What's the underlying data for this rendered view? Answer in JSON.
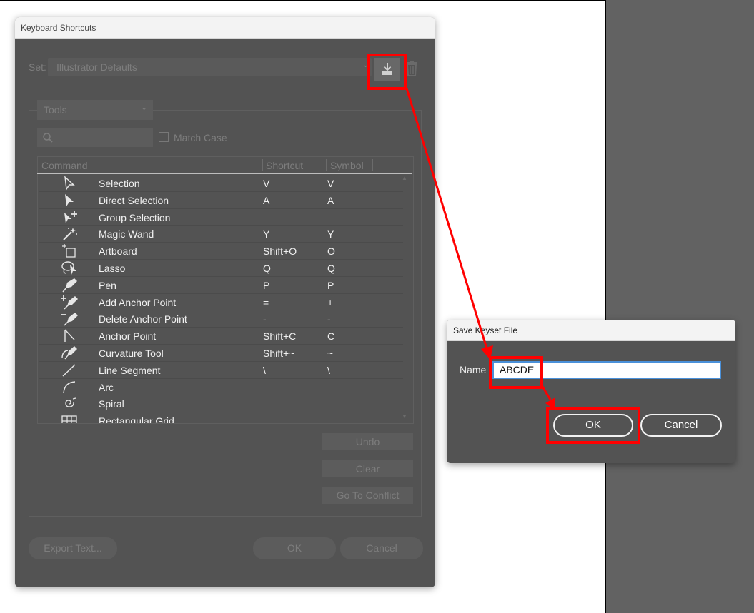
{
  "keyboard_shortcuts_dialog": {
    "title": "Keyboard Shortcuts",
    "set_label": "Set:",
    "set_value": "Illustrator Defaults",
    "tools_dropdown": "Tools",
    "match_case_label": "Match Case",
    "columns": {
      "command": "Command",
      "shortcut": "Shortcut",
      "symbol": "Symbol"
    },
    "rows": [
      {
        "command": "Selection",
        "shortcut": "V",
        "symbol": "V",
        "icon": "selection-tool-icon"
      },
      {
        "command": "Direct Selection",
        "shortcut": "A",
        "symbol": "A",
        "icon": "direct-selection-tool-icon"
      },
      {
        "command": "Group Selection",
        "shortcut": "",
        "symbol": "",
        "icon": "group-selection-tool-icon"
      },
      {
        "command": "Magic Wand",
        "shortcut": "Y",
        "symbol": "Y",
        "icon": "magic-wand-tool-icon"
      },
      {
        "command": "Artboard",
        "shortcut": "Shift+O",
        "symbol": "O",
        "icon": "artboard-tool-icon"
      },
      {
        "command": "Lasso",
        "shortcut": "Q",
        "symbol": "Q",
        "icon": "lasso-tool-icon"
      },
      {
        "command": "Pen",
        "shortcut": "P",
        "symbol": "P",
        "icon": "pen-tool-icon"
      },
      {
        "command": "Add Anchor Point",
        "shortcut": "=",
        "symbol": "+",
        "icon": "add-anchor-point-tool-icon"
      },
      {
        "command": "Delete Anchor Point",
        "shortcut": "-",
        "symbol": "-",
        "icon": "delete-anchor-point-tool-icon"
      },
      {
        "command": "Anchor Point",
        "shortcut": "Shift+C",
        "symbol": "C",
        "icon": "anchor-point-tool-icon"
      },
      {
        "command": "Curvature Tool",
        "shortcut": "Shift+~",
        "symbol": "~",
        "icon": "curvature-tool-icon"
      },
      {
        "command": "Line Segment",
        "shortcut": "\\",
        "symbol": "\\",
        "icon": "line-segment-tool-icon"
      },
      {
        "command": "Arc",
        "shortcut": "",
        "symbol": "",
        "icon": "arc-tool-icon"
      },
      {
        "command": "Spiral",
        "shortcut": "",
        "symbol": "",
        "icon": "spiral-tool-icon"
      },
      {
        "command": "Rectangular Grid",
        "shortcut": "",
        "symbol": "",
        "icon": "rectangular-grid-tool-icon"
      }
    ],
    "buttons": {
      "undo": "Undo",
      "clear": "Clear",
      "go_to_conflict": "Go To Conflict",
      "export_text": "Export Text...",
      "ok": "OK",
      "cancel": "Cancel"
    }
  },
  "save_keyset_dialog": {
    "title": "Save Keyset File",
    "name_label": "Name",
    "name_value": "ABCDE",
    "ok": "OK",
    "cancel": "Cancel"
  },
  "annotation_color": "#ff0000"
}
